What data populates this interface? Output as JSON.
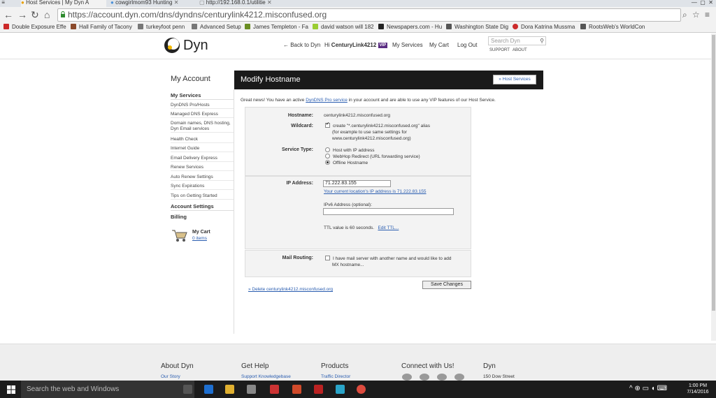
{
  "browser": {
    "tabs": [
      {
        "label": "Host Services | My Dyn A"
      },
      {
        "label": "cowgirlmom93 Hunting"
      },
      {
        "label": "http://192.168.0.1/utilitie"
      }
    ],
    "url": "https://account.dyn.com/dns/dyndns/centurylink4212.misconfused.org",
    "bookmarks": [
      {
        "label": "Double Exposure Effe",
        "color": "#cc2a2a"
      },
      {
        "label": "Hall Family of Tacony",
        "color": "#8b4a2b"
      },
      {
        "label": "turkeyfoot penn",
        "color": "#777777"
      },
      {
        "label": "Advanced Setup",
        "color": "#777777"
      },
      {
        "label": "James Templeton - Fa",
        "color": "#6b8e23"
      },
      {
        "label": "david watson will 182",
        "color": "#9acd32"
      },
      {
        "label": "Newspapers.com - Hu",
        "color": "#222222"
      },
      {
        "label": "Washington State Dig",
        "color": "#555555"
      },
      {
        "label": "Dora Katrina Mussma",
        "color": "#cc2a2a"
      },
      {
        "label": "RootsWeb's WorldCon",
        "color": "#555555"
      }
    ]
  },
  "header": {
    "logo": "Dyn",
    "back": "← Back to Dyn",
    "greeting": "Hi",
    "user": "CenturyLink4212",
    "vip": "VIP",
    "my_services": "My Services",
    "my_cart": "My Cart",
    "logout": "Log Out",
    "search_placeholder": "Search Dyn",
    "support": "SUPPORT",
    "about": "ABOUT"
  },
  "sidebar": {
    "title": "My Account",
    "my_services": "My Services",
    "items": [
      "DynDNS Pro/Hosts",
      "Managed DNS Express",
      "Domain names, DNS hosting, Dyn Email services",
      "Health Check",
      "Internet Guide",
      "Email Delivery Express",
      "Renew Services",
      "Auto Renew Settings",
      "Sync Expirations",
      "Tips on Getting Started"
    ],
    "account_settings": "Account Settings",
    "billing": "Billing",
    "cart_label": "My Cart",
    "cart_items": "0 items"
  },
  "panel": {
    "title": "Modify Hostname",
    "host_services_btn": "» Host Services",
    "notice_pre": "Great news! You have an active",
    "notice_link": "DynDNS Pro service",
    "notice_post": "in your account and are able to use any VIP features of our Host Service.",
    "hostname_label": "Hostname:",
    "hostname_value": "centurylink4212.misconfused.org",
    "wildcard_label": "Wildcard:",
    "wildcard_text": "create \"*.centurylink4212.misconfused.org\" alias",
    "wildcard_text2": "(for example to use same settings for",
    "wildcard_text3": "www.centurylink4212.misconfused.org)",
    "service_type_label": "Service Type:",
    "service_options": [
      "Host with IP address",
      "WebHop Redirect (URL forwarding service)",
      "Offline Hostname"
    ],
    "ip_label": "IP Address:",
    "ip_value": "71.222.83.155",
    "ip_current": "Your current location's IP address is 71.222.83.155",
    "ipv6_label": "IPv6 Address (optional):",
    "ttl_text": "TTL value is 60 seconds.",
    "ttl_edit": "Edit TTL...",
    "mail_label": "Mail Routing:",
    "mail_text": "I have mail server with another name and would like to add",
    "mail_text2": "MX hostname...",
    "delete_link": "» Delete centurylink4212.misconfused.org",
    "save_button": "Save Changes"
  },
  "footer": {
    "columns": [
      {
        "title": "About Dyn",
        "link": "Our Story"
      },
      {
        "title": "Get Help",
        "link": "Support Knowledgebase"
      },
      {
        "title": "Products",
        "link": "Traffic Director"
      },
      {
        "title": "Connect with Us!",
        "link": ""
      },
      {
        "title": "Dyn",
        "link": "150 Dow Street"
      }
    ]
  },
  "taskbar": {
    "search_placeholder": "Search the web and Windows",
    "time": "1:00 PM",
    "date": "7/14/2016"
  }
}
